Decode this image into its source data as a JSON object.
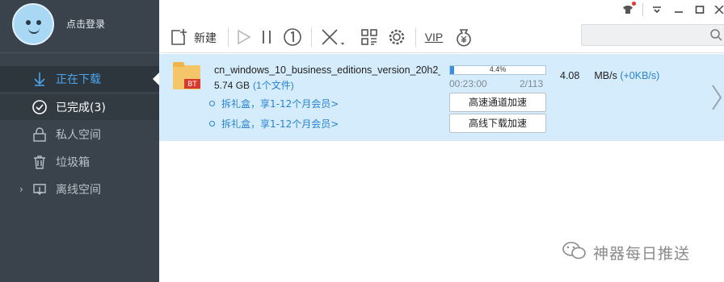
{
  "sidebar": {
    "login_label": "点击登录",
    "items": [
      {
        "label": "正在下载",
        "icon": "download-arrow-icon"
      },
      {
        "label": "已完成(3)",
        "icon": "check-circle-icon"
      },
      {
        "label": "私人空间",
        "icon": "lock-icon"
      },
      {
        "label": "垃圾箱",
        "icon": "trash-icon"
      },
      {
        "label": "离线空间",
        "icon": "cloud-download-icon"
      }
    ],
    "expand_glyph": "›"
  },
  "toolbar": {
    "new_label": "新建",
    "vip_label": "VIP",
    "search_placeholder": ""
  },
  "task": {
    "file_name": "cn_windows_10_business_editions_version_20h2_u...",
    "bt_badge": "BT",
    "file_size": "5.74 GB",
    "file_count": "(1个文件)",
    "promo_1": "拆礼盒，享1-12个月会员>",
    "promo_2": "拆礼盒，享1-12个月会员>",
    "progress_percent": 4.4,
    "progress_text": "4.4%",
    "elapsed": "00:23:00",
    "pieces": "2/113",
    "speed_value": "4.08",
    "speed_unit": "MB/s",
    "speed_extra": "(+0KB/s)",
    "btn_fast": "高速通道加速",
    "btn_offline": "高线下载加速"
  },
  "watermark": "神器每日推送",
  "colors": {
    "sidebar_bg": "#3a434c",
    "accent": "#4aa5ee",
    "task_bg": "#d4ecfb",
    "link": "#2a82d0"
  }
}
